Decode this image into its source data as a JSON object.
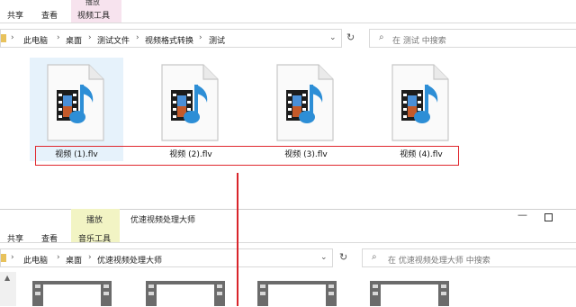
{
  "window1": {
    "tabs": {
      "share": "共享",
      "view": "查看",
      "context_group": "播放",
      "context_tab": "视频工具"
    },
    "breadcrumb": [
      "此电脑",
      "桌面",
      "测试文件",
      "视频格式转换",
      "测试"
    ],
    "search_placeholder": "在 测试 中搜索",
    "files": [
      "视频 (1).flv",
      "视频 (2).flv",
      "视频 (3).flv",
      "视频 (4).flv"
    ]
  },
  "window2": {
    "tabs": {
      "share": "共享",
      "view": "查看",
      "context_group": "播放",
      "context_tab": "音乐工具"
    },
    "title": "优速视频处理大师",
    "breadcrumb": [
      "此电脑",
      "桌面",
      "优速视频处理大师"
    ],
    "search_placeholder": "在 优速视频处理大师 中搜索"
  },
  "icons": [
    "refresh-icon",
    "search-icon",
    "chevron-down-icon",
    "minimize-icon",
    "maximize-icon",
    "media-file-icon",
    "scroll-up-icon"
  ],
  "colors": {
    "highlight_box": "#e0282e",
    "context_tab_video": "#f7e3ee",
    "context_tab_music": "#f2f4c4",
    "selected_file": "#e6f2fb"
  }
}
